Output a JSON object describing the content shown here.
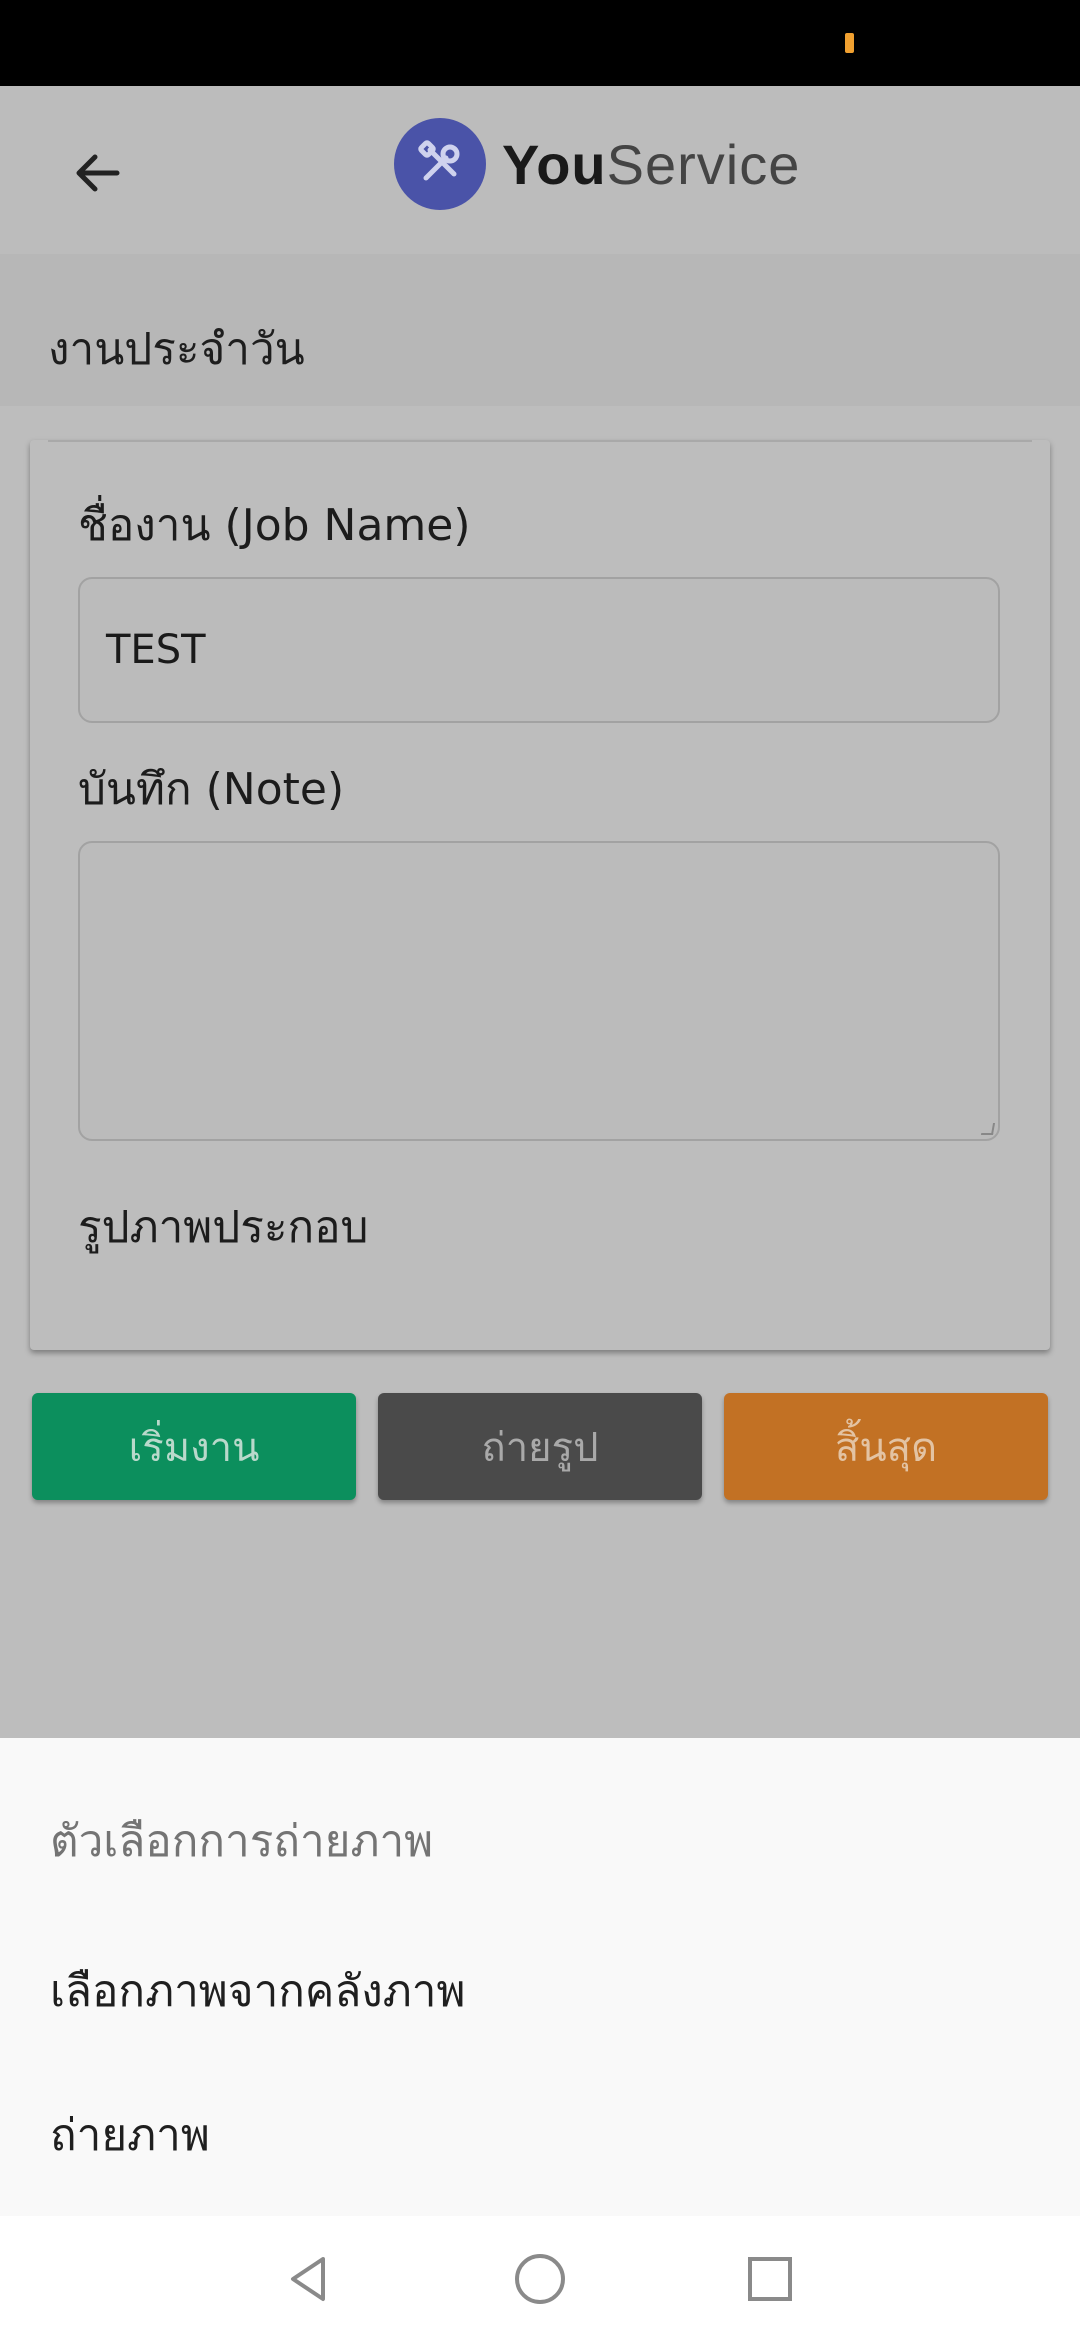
{
  "status_bar": {
    "indicator_color": "#f0a030"
  },
  "app_bar": {
    "back_icon": "arrow-left-icon",
    "logo_icon": "tools-icon",
    "logo_bold": "You",
    "logo_light": "Service",
    "logo_color": "#4a53a8"
  },
  "section": {
    "title": "งานประจำวัน"
  },
  "form": {
    "job_name_label": "ชื่องาน (Job Name)",
    "job_name_value": "TEST",
    "note_label": "บันทึก (Note)",
    "note_value": "",
    "photo_label": "รูปภาพประกอบ"
  },
  "actions": {
    "start_label": "เริ่มงาน",
    "photo_label": "ถ่ายรูป",
    "end_label": "สิ้นสุด",
    "start_color": "#0c8f5d",
    "photo_color": "#4a4a4a",
    "end_color": "#c27124"
  },
  "bottom_sheet": {
    "title": "ตัวเลือกการถ่ายภาพ",
    "options": [
      {
        "label": "เลือกภาพจากคลังภาพ"
      },
      {
        "label": "ถ่ายภาพ"
      }
    ]
  },
  "nav": {
    "back_icon": "triangle-back-icon",
    "home_icon": "circle-home-icon",
    "recents_icon": "square-recents-icon"
  }
}
